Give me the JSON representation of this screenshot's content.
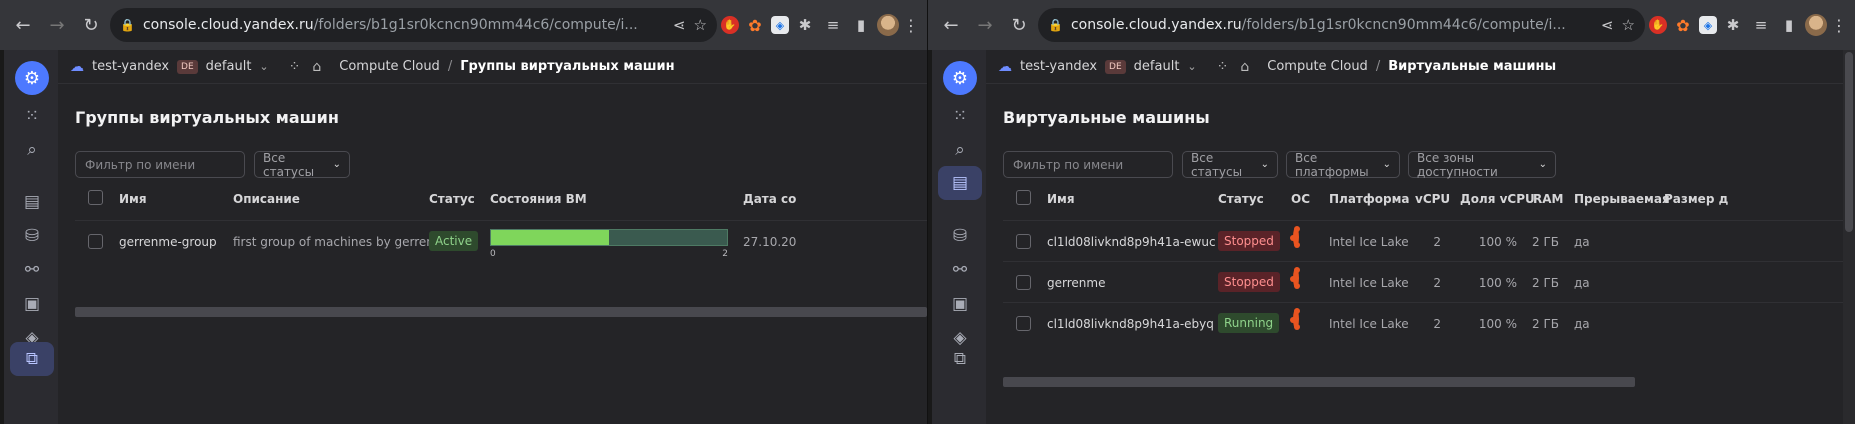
{
  "browser": {
    "url_host": "console.cloud.yandex.ru",
    "url_rest": "/folders/b1g1sr0kcncn90mm44c6/compute/i..."
  },
  "left": {
    "topbar": {
      "cloud": "test-yandex",
      "folder_badge": "DE",
      "folder": "default",
      "crumb_service": "Compute Cloud",
      "crumb_sep": "/",
      "crumb_current": "Группы виртуальных машин"
    },
    "title": "Группы виртуальных машин",
    "filter_placeholder": "Фильтр по имени",
    "status_dropdown": "Все статусы",
    "columns": [
      "Имя",
      "Описание",
      "Статус",
      "Состояния ВМ",
      "Дата со"
    ],
    "rows": [
      {
        "name": "gerrenme-group",
        "description": "first group of machines by gerrenme",
        "status": "Active",
        "vm_states_ratio": 0.5,
        "scale_min": "0",
        "scale_max": "2",
        "date": "27.10.20"
      }
    ]
  },
  "right": {
    "topbar": {
      "cloud": "test-yandex",
      "folder_badge": "DE",
      "folder": "default",
      "crumb_service": "Compute Cloud",
      "crumb_sep": "/",
      "crumb_current": "Виртуальные машины"
    },
    "title": "Виртуальные машины",
    "filter_placeholder": "Фильтр по имени",
    "status_dropdown": "Все статусы",
    "platform_dropdown": "Все платформы",
    "zone_dropdown": "Все зоны доступности",
    "columns": [
      "Имя",
      "Статус",
      "ОС",
      "Платформа",
      "vCPU",
      "Доля vCPU",
      "RAM",
      "Прерываемая",
      "Размер д"
    ],
    "rows": [
      {
        "name": "cl1ld08livknd8p9h41a-ewuc",
        "status": "Stopped",
        "platform": "Intel Ice Lake",
        "vcpu": "2",
        "share": "100 %",
        "ram": "2 ГБ",
        "preemptible": "да"
      },
      {
        "name": "gerrenme",
        "status": "Stopped",
        "platform": "Intel Ice Lake",
        "vcpu": "2",
        "share": "100 %",
        "ram": "2 ГБ",
        "preemptible": "да"
      },
      {
        "name": "cl1ld08livknd8p9h41a-ebyq",
        "status": "Running",
        "platform": "Intel Ice Lake",
        "vcpu": "2",
        "share": "100 %",
        "ram": "2 ГБ",
        "preemptible": "да"
      }
    ]
  }
}
